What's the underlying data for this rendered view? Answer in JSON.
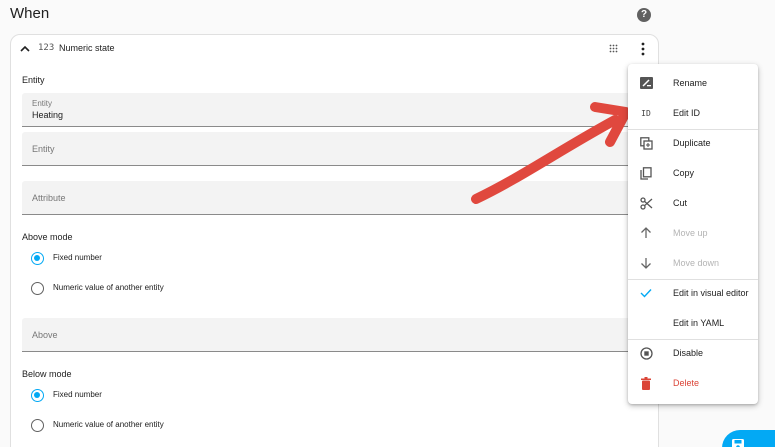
{
  "section": {
    "title": "When"
  },
  "card": {
    "type_icon": "123",
    "title": "Numeric state"
  },
  "form": {
    "entity_label": "Entity",
    "entity_field": {
      "label": "Entity",
      "value": "Heating"
    },
    "entity_placeholder": "Entity",
    "attribute_placeholder": "Attribute",
    "above_mode": {
      "label": "Above mode",
      "options": [
        {
          "label": "Fixed number",
          "checked": true
        },
        {
          "label": "Numeric value of another entity",
          "checked": false
        }
      ]
    },
    "above_placeholder": "Above",
    "below_mode": {
      "label": "Below mode",
      "options": [
        {
          "label": "Fixed number",
          "checked": true
        },
        {
          "label": "Numeric value of another entity",
          "checked": false
        }
      ]
    }
  },
  "menu": {
    "items": [
      {
        "label": "Rename",
        "icon": "rename-icon",
        "state": "normal"
      },
      {
        "label": "Edit ID",
        "icon": "id-icon",
        "state": "normal"
      },
      {
        "label": "Duplicate",
        "icon": "duplicate-icon",
        "state": "normal"
      },
      {
        "label": "Copy",
        "icon": "copy-icon",
        "state": "normal"
      },
      {
        "label": "Cut",
        "icon": "scissors-icon",
        "state": "normal"
      },
      {
        "label": "Move up",
        "icon": "arrow-up-icon",
        "state": "disabled"
      },
      {
        "label": "Move down",
        "icon": "arrow-down-icon",
        "state": "disabled"
      },
      {
        "label": "Edit in visual editor",
        "icon": "check-icon",
        "state": "selected"
      },
      {
        "label": "Edit in YAML",
        "icon": "",
        "state": "normal"
      },
      {
        "label": "Disable",
        "icon": "stop-circle-icon",
        "state": "normal"
      },
      {
        "label": "Delete",
        "icon": "trash-icon",
        "state": "danger"
      }
    ]
  },
  "colors": {
    "accent": "#03a9f4",
    "danger": "#db4437",
    "annotation_arrow": "#e0483e"
  }
}
